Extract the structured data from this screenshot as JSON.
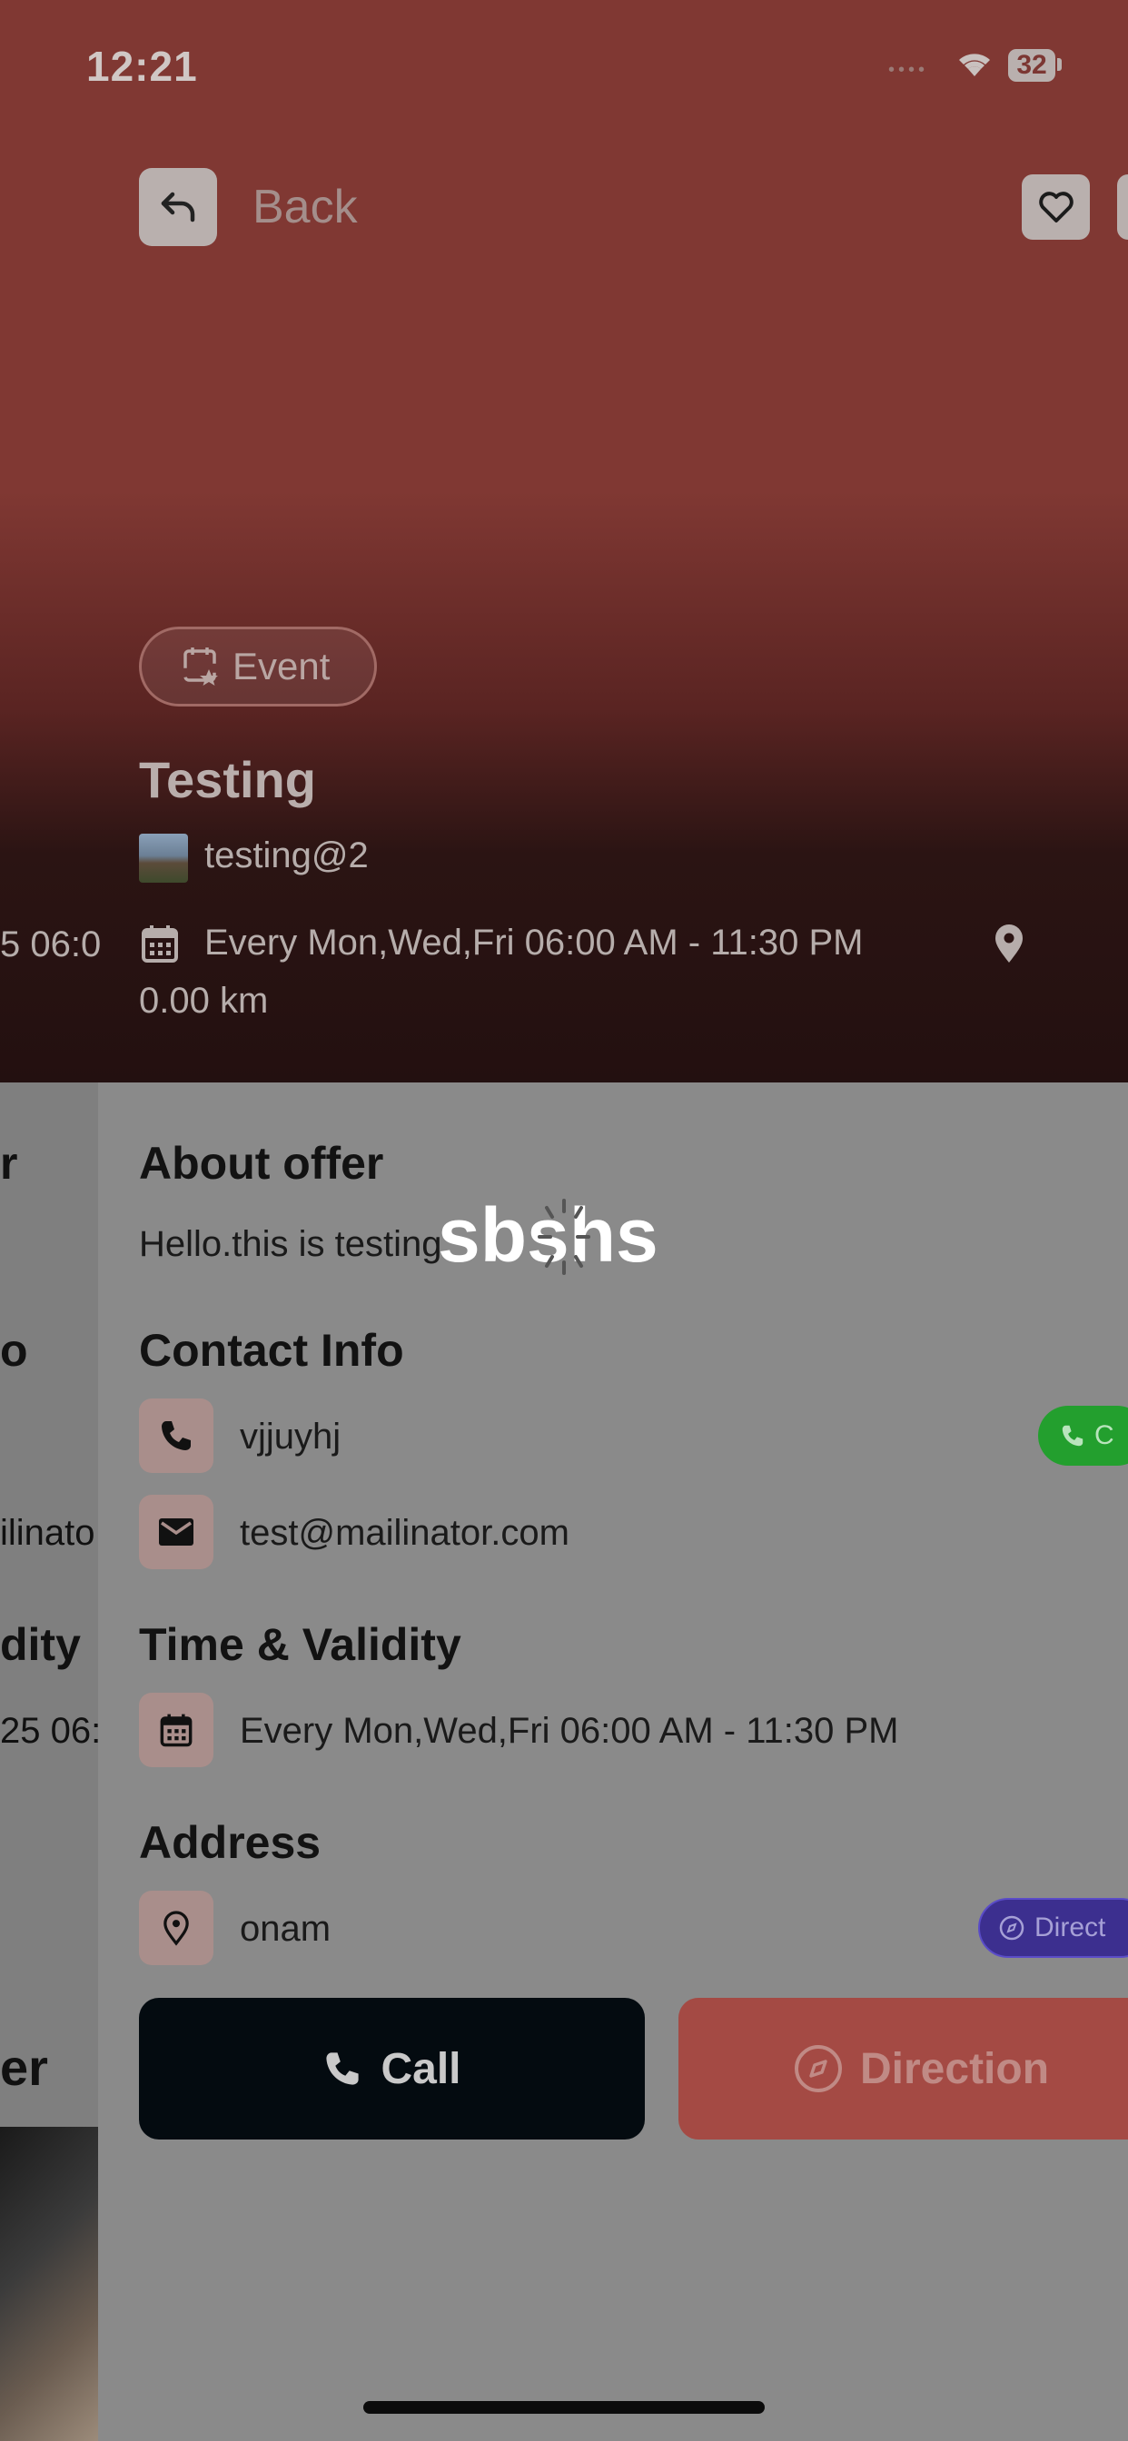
{
  "status_bar": {
    "time": "12:21",
    "signal": "••••",
    "battery": "32"
  },
  "header": {
    "back_label": "Back"
  },
  "event": {
    "type_label": "Event",
    "title": "Testing",
    "organizer": "testing@2",
    "schedule": "Every Mon,Wed,Fri 06:00 AM - 11:30 PM",
    "distance": "0.00 km"
  },
  "overlay": {
    "text": "sbshs"
  },
  "sections": {
    "about": {
      "title": "About offer",
      "text": "Hello.this is testing"
    },
    "contact": {
      "title": "Contact Info",
      "phone": "vjjuyhj",
      "email": "test@mailinator.com",
      "call_pill": "C"
    },
    "time": {
      "title": "Time & Validity",
      "schedule": "Every Mon,Wed,Fri 06:00 AM - 11:30 PM"
    },
    "address": {
      "title": "Address",
      "text": "onam",
      "direction_pill": "Direct"
    }
  },
  "actions": {
    "call_label": "Call",
    "direction_label": "Direction"
  },
  "peek": {
    "time_fragment": "5 06:0",
    "about_fragment": "r",
    "contact_fragment": "o",
    "email_fragment": "ilinato",
    "time_fragment_title": "dity",
    "validity_fragment": "25 06:",
    "offer_fragment": "er"
  }
}
